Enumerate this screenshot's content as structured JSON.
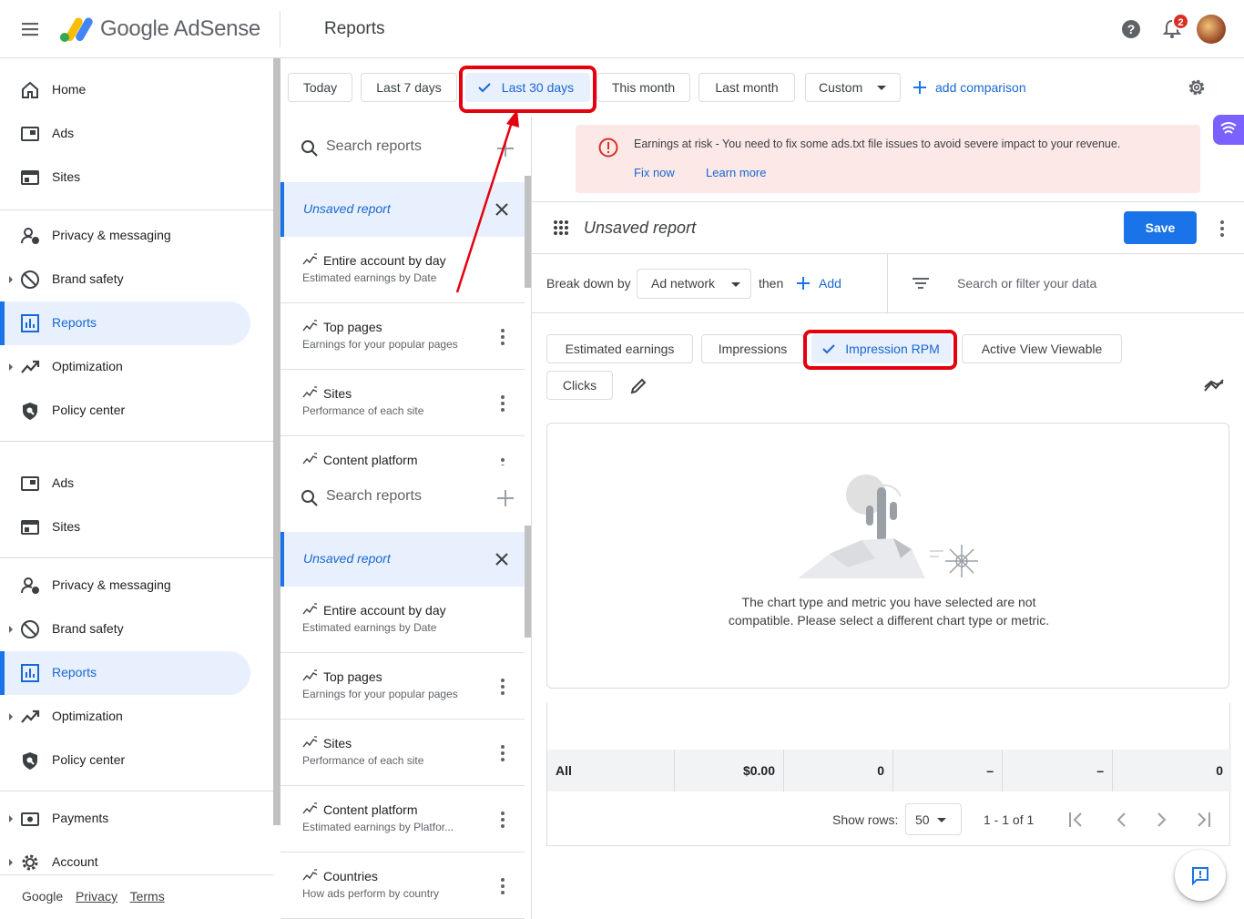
{
  "topbar": {
    "brand": "Google AdSense",
    "page_title": "Reports",
    "notification_count": "2",
    "icons": [
      "menu-icon",
      "adsense-logo",
      "help-icon",
      "bell-icon",
      "avatar"
    ]
  },
  "nav": {
    "items_a": [
      {
        "label": "Home",
        "icon": "home-icon"
      },
      {
        "label": "Ads",
        "icon": "ads-icon"
      },
      {
        "label": "Sites",
        "icon": "sites-icon"
      },
      {
        "label": "Privacy & messaging",
        "icon": "privacy-icon"
      },
      {
        "label": "Brand safety",
        "icon": "block-icon"
      },
      {
        "label": "Reports",
        "icon": "reports-icon",
        "active": true
      },
      {
        "label": "Optimization",
        "icon": "trending-icon"
      },
      {
        "label": "Policy center",
        "icon": "policy-icon"
      }
    ],
    "items_b": [
      {
        "label": "Ads",
        "icon": "ads-icon"
      },
      {
        "label": "Sites",
        "icon": "sites-icon"
      },
      {
        "label": "Privacy & messaging",
        "icon": "privacy-icon"
      },
      {
        "label": "Brand safety",
        "icon": "block-icon"
      },
      {
        "label": "Reports",
        "icon": "reports-icon",
        "active": true
      },
      {
        "label": "Optimization",
        "icon": "trending-icon"
      },
      {
        "label": "Policy center",
        "icon": "policy-icon"
      },
      {
        "label": "Payments",
        "icon": "payments-icon"
      },
      {
        "label": "Account",
        "icon": "gear-icon"
      }
    ],
    "footer": {
      "google": "Google",
      "privacy": "Privacy",
      "terms": "Terms"
    }
  },
  "date_range": {
    "options": [
      "Today",
      "Last 7 days",
      "Last 30 days",
      "This month",
      "Last month",
      "Custom"
    ],
    "selected": "Last 30 days",
    "add_comparison": "add comparison"
  },
  "report_list": {
    "search_placeholder": "Search reports",
    "unsaved_label": "Unsaved report",
    "items": [
      {
        "title": "Entire account by day",
        "subtitle": "Estimated earnings by Date"
      },
      {
        "title": "Top pages",
        "subtitle": "Earnings for your popular pages"
      },
      {
        "title": "Sites",
        "subtitle": "Performance of each site"
      },
      {
        "title": "Content platform",
        "subtitle": "Estimated earnings by Platfor..."
      },
      {
        "title": "Countries",
        "subtitle": "How ads perform by country"
      }
    ]
  },
  "alert": {
    "message": "Earnings at risk - You need to fix some ads.txt file issues to avoid severe impact to your revenue.",
    "fix_now": "Fix now",
    "learn_more": "Learn more"
  },
  "report": {
    "title": "Unsaved report",
    "save_label": "Save",
    "break_down_by": "Break down by",
    "dimension": "Ad network",
    "then": "then",
    "add": "Add",
    "filter_placeholder": "Search or filter your data",
    "metrics": [
      "Estimated earnings",
      "Impressions",
      "Impression RPM",
      "Active View Viewable",
      "Clicks"
    ],
    "selected_metric": "Impression RPM",
    "chart_message_1": "The chart type and metric you have selected are not",
    "chart_message_2": "compatible. Please select a different chart type or metric."
  },
  "table": {
    "row": [
      "All",
      "$0.00",
      "0",
      "–",
      "–",
      "0"
    ],
    "show_rows_label": "Show rows:",
    "rows_value": "50",
    "range": "1 - 1 of 1"
  },
  "colors": {
    "accent": "#1a73e8",
    "alert_bg": "#fce8e6",
    "annotation_red": "#e4000f"
  }
}
